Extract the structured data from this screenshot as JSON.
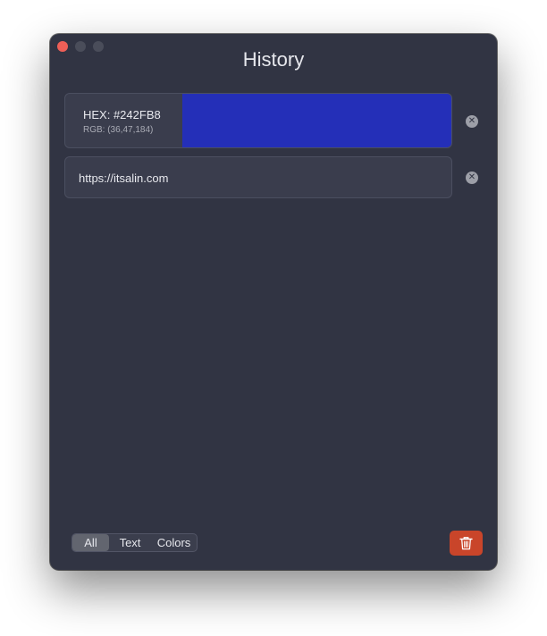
{
  "window": {
    "title": "History"
  },
  "history": {
    "items": [
      {
        "type": "color",
        "hex_label": "HEX: #242FB8",
        "rgb_label": "RGB: (36,47,184)",
        "swatch_color": "#242FB8"
      },
      {
        "type": "text",
        "value": "https://itsalin.com"
      }
    ]
  },
  "filter": {
    "options": [
      "All",
      "Text",
      "Colors"
    ],
    "selected": "All"
  },
  "icons": {
    "remove": "clear-x-icon",
    "clear_all": "trash-icon"
  },
  "colors": {
    "window_bg": "#313443",
    "accent_delete": "#C9452A",
    "close_dot": "#EE5F57"
  }
}
